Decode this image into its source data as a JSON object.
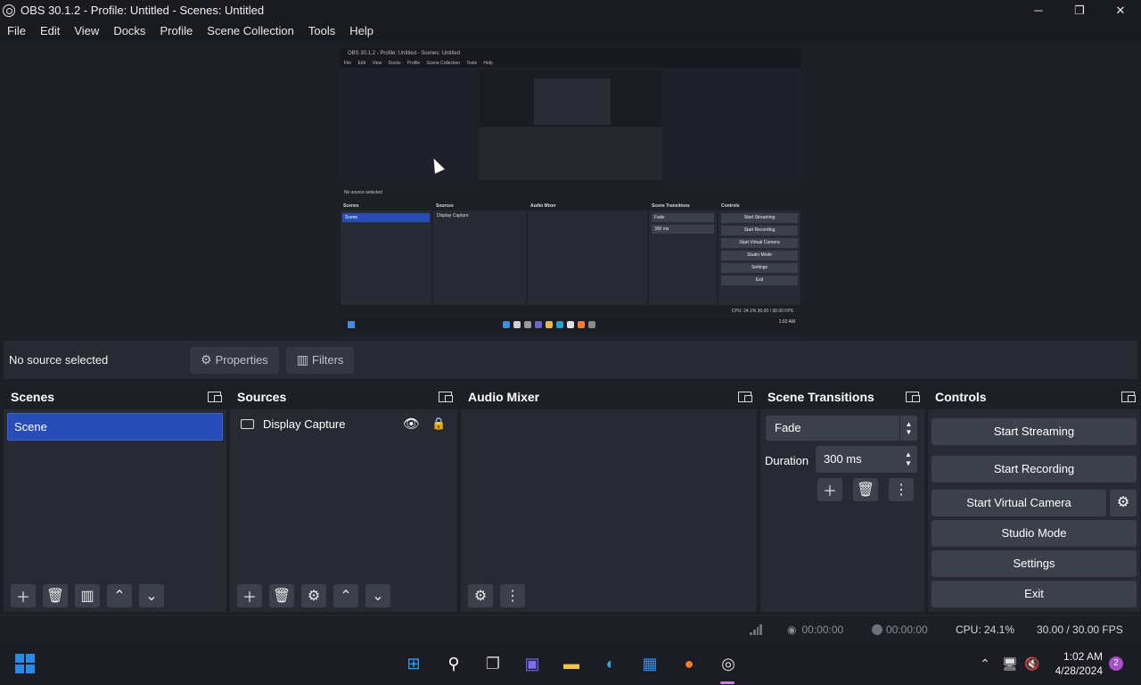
{
  "window": {
    "title": "OBS 30.1.2 - Profile: Untitled - Scenes: Untitled",
    "minimize": "─",
    "maximize": "❐",
    "close": "✕"
  },
  "menu": [
    "File",
    "Edit",
    "View",
    "Docks",
    "Profile",
    "Scene Collection",
    "Tools",
    "Help"
  ],
  "preview": {
    "mini_title": "OBS 30.1.2 - Profile: Untitled - Scenes: Untitled",
    "mini_menu": [
      "File",
      "Edit",
      "View",
      "Docks",
      "Profile",
      "Scene Collection",
      "Tools",
      "Help"
    ],
    "mini_context": "No source selected",
    "mini_docks": [
      "Scenes",
      "Sources",
      "Audio Mixer",
      "Scene Transitions",
      "Controls"
    ],
    "mini_scene": "Scene",
    "mini_source": "Display Capture",
    "mini_transition": "Fade",
    "mini_duration": "300 ms",
    "mini_controls": [
      "Start Streaming",
      "Start Recording",
      "Start Virtual Camera",
      "Studio Mode",
      "Settings",
      "Exit"
    ],
    "mini_status": "CPU: 24.1%   30.00 / 30.00 FPS",
    "mini_clock": "1:02 AM"
  },
  "context_bar": {
    "no_source": "No source selected",
    "properties": "Properties",
    "filters": "Filters"
  },
  "docks": {
    "scenes": {
      "title": "Scenes",
      "items": [
        "Scene"
      ]
    },
    "sources": {
      "title": "Sources",
      "items": [
        {
          "name": "Display Capture",
          "icon": "monitor-icon"
        }
      ]
    },
    "audio_mixer": {
      "title": "Audio Mixer"
    },
    "transitions": {
      "title": "Scene Transitions",
      "selected": "Fade",
      "duration_label": "Duration",
      "duration_value": "300 ms"
    },
    "controls": {
      "title": "Controls",
      "start_streaming": "Start Streaming",
      "start_recording": "Start Recording",
      "start_virtual_camera": "Start Virtual Camera",
      "studio_mode": "Studio Mode",
      "settings": "Settings",
      "exit": "Exit"
    }
  },
  "status": {
    "stream_time": "00:00:00",
    "record_time": "00:00:00",
    "cpu": "CPU: 24.1%",
    "fps": "30.00 / 30.00 FPS"
  },
  "taskbar": {
    "time": "1:02 AM",
    "date": "4/28/2024",
    "notifications": "2"
  },
  "colors": {
    "accent": "#284cb8",
    "panel": "#272a33",
    "button": "#3c404b",
    "background": "#1d1f26"
  }
}
